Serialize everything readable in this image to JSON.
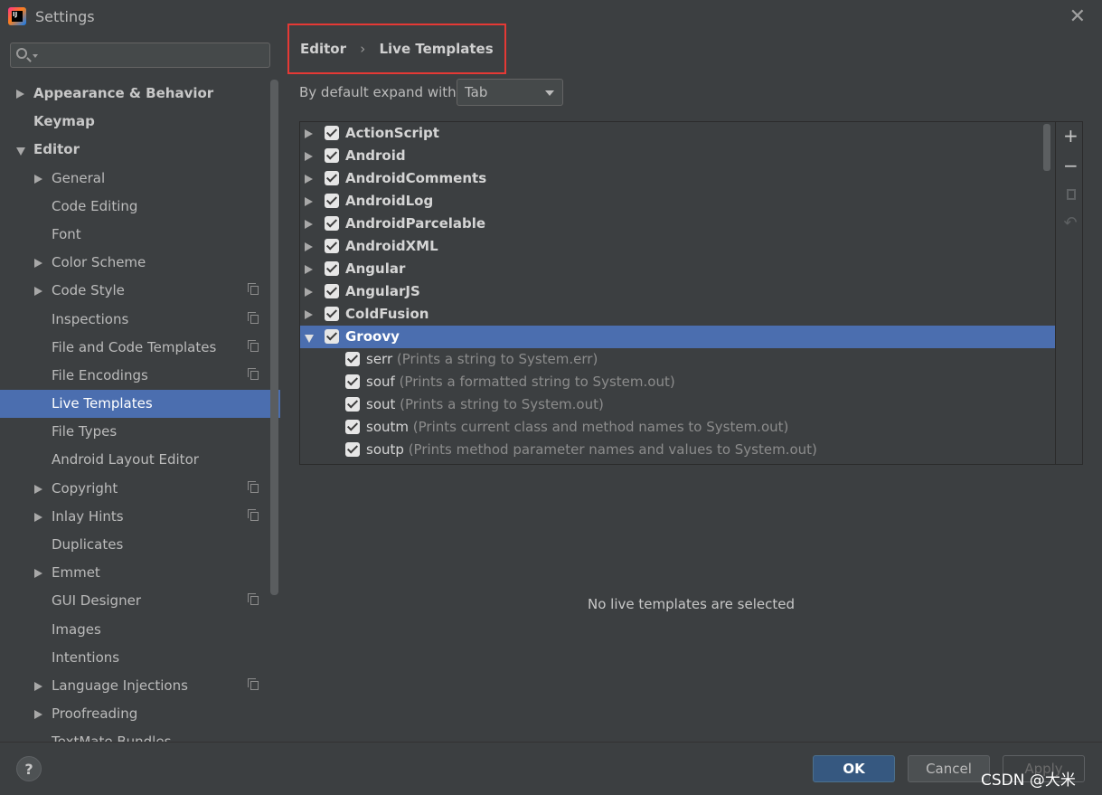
{
  "window": {
    "title": "Settings",
    "app_icon_text": "IJ"
  },
  "search": {
    "placeholder": ""
  },
  "sidebar": {
    "items": [
      {
        "label": "Appearance & Behavior",
        "level": 0,
        "expander": "collapsed",
        "bold": true
      },
      {
        "label": "Keymap",
        "level": 0,
        "expander": "none",
        "bold": true
      },
      {
        "label": "Editor",
        "level": 0,
        "expander": "expanded",
        "bold": true
      },
      {
        "label": "General",
        "level": 1,
        "expander": "collapsed"
      },
      {
        "label": "Code Editing",
        "level": 1,
        "expander": "none"
      },
      {
        "label": "Font",
        "level": 1,
        "expander": "none"
      },
      {
        "label": "Color Scheme",
        "level": 1,
        "expander": "collapsed"
      },
      {
        "label": "Code Style",
        "level": 1,
        "expander": "collapsed",
        "project_icon": true
      },
      {
        "label": "Inspections",
        "level": 1,
        "expander": "none",
        "project_icon": true
      },
      {
        "label": "File and Code Templates",
        "level": 1,
        "expander": "none",
        "project_icon": true
      },
      {
        "label": "File Encodings",
        "level": 1,
        "expander": "none",
        "project_icon": true
      },
      {
        "label": "Live Templates",
        "level": 1,
        "expander": "none",
        "selected": true
      },
      {
        "label": "File Types",
        "level": 1,
        "expander": "none"
      },
      {
        "label": "Android Layout Editor",
        "level": 1,
        "expander": "none"
      },
      {
        "label": "Copyright",
        "level": 1,
        "expander": "collapsed",
        "project_icon": true
      },
      {
        "label": "Inlay Hints",
        "level": 1,
        "expander": "collapsed",
        "project_icon": true
      },
      {
        "label": "Duplicates",
        "level": 1,
        "expander": "none"
      },
      {
        "label": "Emmet",
        "level": 1,
        "expander": "collapsed"
      },
      {
        "label": "GUI Designer",
        "level": 1,
        "expander": "none",
        "project_icon": true
      },
      {
        "label": "Images",
        "level": 1,
        "expander": "none"
      },
      {
        "label": "Intentions",
        "level": 1,
        "expander": "none"
      },
      {
        "label": "Language Injections",
        "level": 1,
        "expander": "collapsed",
        "project_icon": true
      },
      {
        "label": "Proofreading",
        "level": 1,
        "expander": "collapsed"
      },
      {
        "label": "TextMate Bundles",
        "level": 1,
        "expander": "none"
      }
    ]
  },
  "breadcrumb": {
    "parent": "Editor",
    "separator": "›",
    "current": "Live Templates"
  },
  "expand": {
    "label": "By default expand with",
    "value": "Tab"
  },
  "templates": {
    "groups": [
      {
        "name": "ActionScript",
        "checked": true,
        "expanded": false
      },
      {
        "name": "Android",
        "checked": true,
        "expanded": false
      },
      {
        "name": "AndroidComments",
        "checked": true,
        "expanded": false
      },
      {
        "name": "AndroidLog",
        "checked": true,
        "expanded": false
      },
      {
        "name": "AndroidParcelable",
        "checked": true,
        "expanded": false
      },
      {
        "name": "AndroidXML",
        "checked": true,
        "expanded": false
      },
      {
        "name": "Angular",
        "checked": true,
        "expanded": false
      },
      {
        "name": "AngularJS",
        "checked": true,
        "expanded": false
      },
      {
        "name": "ColdFusion",
        "checked": true,
        "expanded": false
      },
      {
        "name": "Groovy",
        "checked": true,
        "expanded": true,
        "selected": true,
        "children": [
          {
            "abbr": "serr",
            "desc": "(Prints a string to System.err)",
            "checked": true
          },
          {
            "abbr": "souf",
            "desc": "(Prints a formatted string to System.out)",
            "checked": true
          },
          {
            "abbr": "sout",
            "desc": "(Prints a string to System.out)",
            "checked": true
          },
          {
            "abbr": "soutm",
            "desc": "(Prints current class and method names to System.out)",
            "checked": true
          },
          {
            "abbr": "soutp",
            "desc": "(Prints method parameter names and values to System.out)",
            "checked": true
          }
        ]
      }
    ]
  },
  "toolbar": {
    "add": "+",
    "remove": "−",
    "undo": "↶"
  },
  "empty_message": "No live templates are selected",
  "footer": {
    "help": "?",
    "ok": "OK",
    "cancel": "Cancel",
    "apply": "Apply"
  },
  "watermark": "CSDN @大米",
  "colors": {
    "accent": "#4b6eaf",
    "highlight_border": "#e53935",
    "ok_button": "#365880",
    "background": "#3c3f41"
  }
}
